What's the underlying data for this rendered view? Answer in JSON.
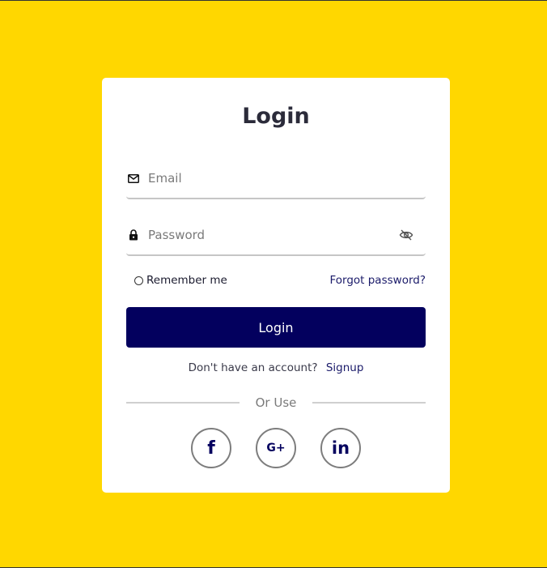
{
  "colors": {
    "background": "#ffd700",
    "card": "#ffffff",
    "primary": "#03005e",
    "muted": "#7a7a7a"
  },
  "form": {
    "title": "Login",
    "email": {
      "placeholder": "Email",
      "value": "",
      "icon": "envelope-icon"
    },
    "password": {
      "placeholder": "Password",
      "value": "",
      "icon": "lock-icon",
      "toggle_icon": "eye-off-icon"
    },
    "remember_label": "Remember me",
    "remember_checked": false,
    "forgot_label": "Forgot password?",
    "submit_label": "Login",
    "signup_prompt": "Don't have an account?",
    "signup_label": "Signup",
    "divider_label": "Or Use"
  },
  "socials": [
    {
      "name": "facebook",
      "glyph": "f"
    },
    {
      "name": "google-plus",
      "glyph": "G+"
    },
    {
      "name": "linkedin",
      "glyph": "in"
    }
  ]
}
